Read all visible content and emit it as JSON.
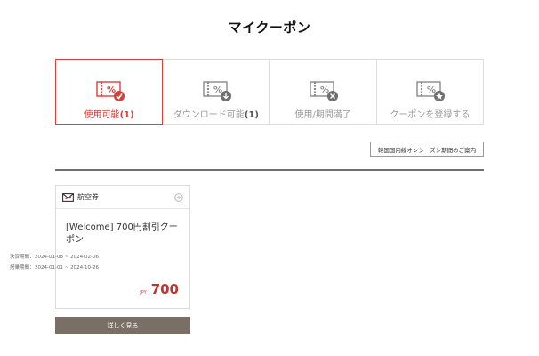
{
  "page": {
    "title": "マイクーポン"
  },
  "tabs": [
    {
      "label": "使用可能",
      "count": "(1)",
      "icon": "coupon-check-icon",
      "active": true
    },
    {
      "label": "ダウンロード可能",
      "count": "(1)",
      "icon": "coupon-download-icon",
      "active": false
    },
    {
      "label": "使用/期間満了",
      "count": "",
      "icon": "coupon-expired-icon",
      "active": false
    },
    {
      "label": "クーポンを登録する",
      "count": "",
      "icon": "coupon-register-icon",
      "active": false
    }
  ],
  "info_button": {
    "label": "韓国国内線オンシーズン期間のご案内"
  },
  "coupon": {
    "type_label": "航空券",
    "title": "[Welcome] 700円割引クーポン",
    "dates": [
      {
        "label": "決済期間",
        "sep": "：",
        "value": "2024-01-08 ~ 2024-02-06"
      },
      {
        "label": "搭乗期間",
        "sep": "：",
        "value": "2024-01-01 ~ 2024-10-26"
      }
    ],
    "currency": "JPY",
    "amount": "700"
  },
  "detail_button": {
    "label": "詳しく見る"
  },
  "colors": {
    "accent": "#d9403a",
    "price": "#c8322c",
    "button_bg": "#7a6f67",
    "divider": "#6f6f6f"
  }
}
